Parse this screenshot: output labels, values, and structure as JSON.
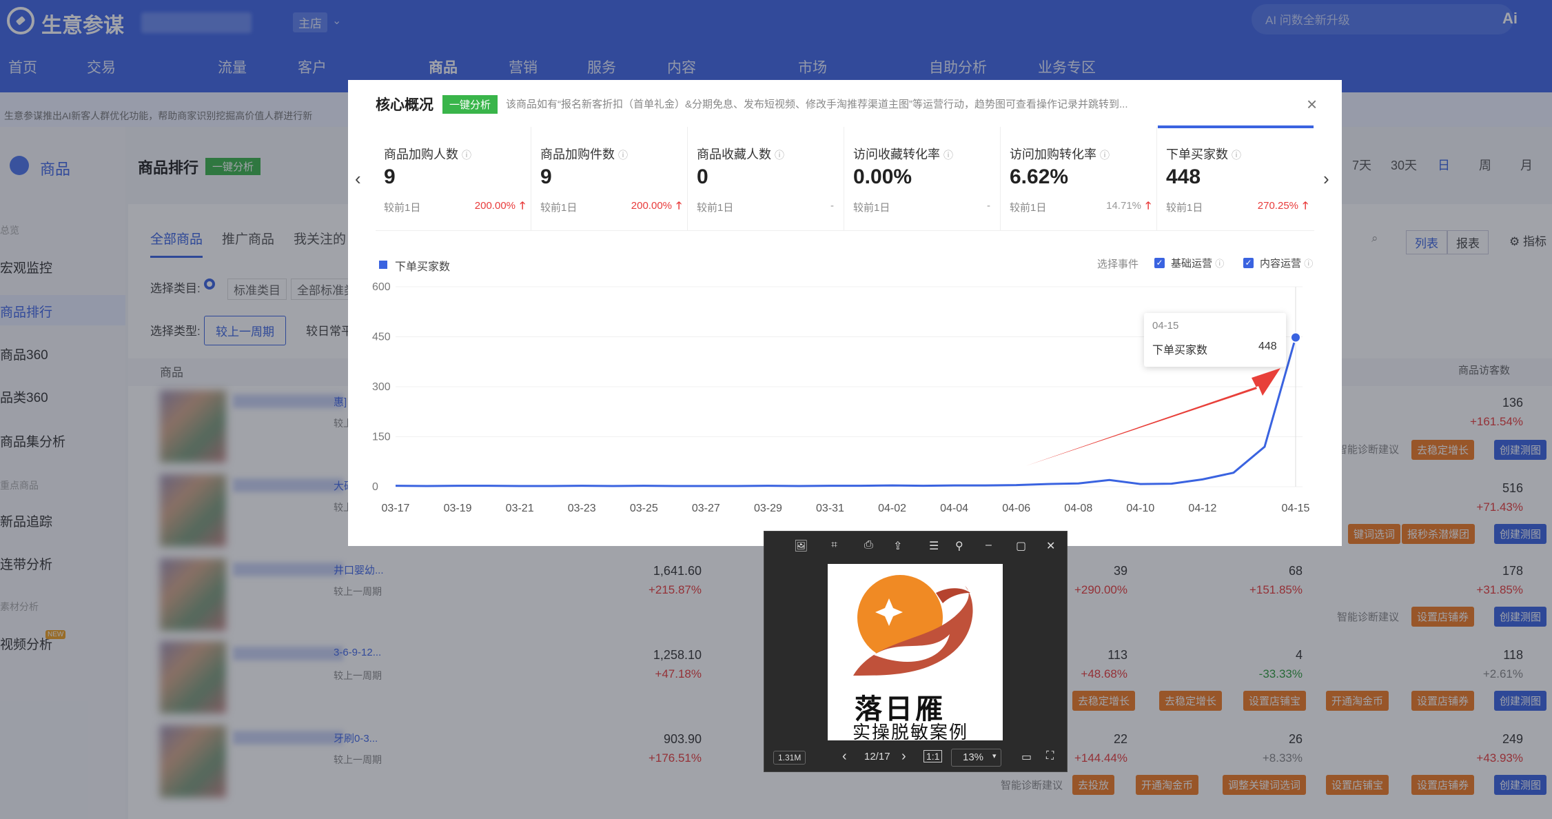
{
  "app": {
    "brand": "生意参谋",
    "shop_badge": "主店",
    "ai_search_placeholder": "AI 问数全新升级"
  },
  "nav": [
    "首页",
    "交易",
    "流量",
    "客户",
    "商品",
    "营销",
    "服务",
    "内容",
    "市场",
    "自助分析",
    "业务专区"
  ],
  "announcement": "生意参谋推出AI新客人群优化功能，帮助商家识别挖掘高价值人群进行新",
  "sidebar": {
    "title": "商品",
    "groups": [
      {
        "label": "总览",
        "items": [
          "宏观监控",
          "商品排行",
          "商品360",
          "品类360",
          "商品集分析"
        ]
      },
      {
        "label": "重点商品",
        "items": [
          "新品追踪",
          "连带分析"
        ]
      },
      {
        "label": "素材分析",
        "items": [
          "视频分析"
        ]
      }
    ],
    "new_badge": "NEW"
  },
  "main": {
    "title": "商品排行",
    "ai_button": "一键分析",
    "periods": [
      "7天",
      "30天",
      "日",
      "周",
      "月"
    ],
    "tabs": [
      "全部商品",
      "推广商品",
      "我关注的"
    ],
    "filter_category_label": "选择类目:",
    "filter_category_values": [
      "标准类目",
      "全部标准类"
    ],
    "filter_type_label": "选择类型:",
    "filter_type_values": [
      "较上一周期",
      "较日常平"
    ],
    "view_buttons": [
      "列表",
      "报表"
    ],
    "indicator_button": "指标",
    "col_product": "商品",
    "col_visitors": "商品访客数",
    "rows": [
      {
        "suffix": "惠]",
        "cmp": "较上",
        "visitors": "136",
        "visitors_pct": "+161.54%",
        "tags": [
          "去稳定增长"
        ]
      },
      {
        "suffix": "大码",
        "cmp": "较上",
        "visitors": "516",
        "visitors_pct": "+71.43%",
        "tags": [
          "键词选词",
          "报秒杀潜爆团"
        ]
      },
      {
        "suffix": "井口婴幼...",
        "cmp": "较上一周期",
        "amount": "1,641.60",
        "amount_pct": "+215.87%",
        "c1": "39",
        "c1_pct": "+290.00%",
        "c2": "68",
        "c2_pct": "+151.85%",
        "visitors": "178",
        "visitors_pct": "+31.85%",
        "tags": [
          "设置店铺券"
        ]
      },
      {
        "suffix": "3-6-9-12...",
        "cmp": "较上一周期",
        "amount": "1,258.10",
        "amount_pct": "+47.18%",
        "c1": "113",
        "c1_pct": "+48.68%",
        "c2": "4",
        "c2_pct": "-33.33%",
        "visitors": "118",
        "visitors_pct": "+2.61%",
        "tags": [
          "去稳定增长",
          "去稳定增长",
          "设置店铺宝",
          "开通淘金币",
          "设置店铺券"
        ]
      },
      {
        "suffix": "牙刷0-3...",
        "cmp": "较上一周期",
        "amount": "903.90",
        "amount_pct": "+176.51%",
        "c1": "22",
        "c1_pct": "+144.44%",
        "c2": "26",
        "c2_pct": "+8.33%",
        "visitors": "249",
        "visitors_pct": "+43.93%",
        "tags": [
          "去投放",
          "开通淘金币",
          "调整关键词选词",
          "设置店铺宝",
          "设置店铺券"
        ]
      }
    ],
    "diag_label": "智能诊断建议",
    "create_label": "创建测图"
  },
  "modal": {
    "title": "核心概况",
    "ai_button": "一键分析",
    "description": "该商品如有“报名新客折扣（首单礼金）&分期免息、发布短视频、修改手淘推荐渠道主图”等运营行动，趋势图可查看操作记录并跳转到...",
    "close": "×",
    "metrics": [
      {
        "label": "商品加购人数",
        "value": "9",
        "compare_label": "较前1日",
        "change": "200.00%",
        "trend": "up"
      },
      {
        "label": "商品加购件数",
        "value": "9",
        "compare_label": "较前1日",
        "change": "200.00%",
        "trend": "up"
      },
      {
        "label": "商品收藏人数",
        "value": "0",
        "compare_label": "较前1日",
        "change": "-",
        "trend": "none"
      },
      {
        "label": "访问收藏转化率",
        "value": "0.00%",
        "compare_label": "较前1日",
        "change": "-",
        "trend": "none"
      },
      {
        "label": "访问加购转化率",
        "value": "6.62%",
        "compare_label": "较前1日",
        "change": "14.71%",
        "trend": "up-gray"
      },
      {
        "label": "下单买家数",
        "value": "448",
        "compare_label": "较前1日",
        "change": "270.25%",
        "trend": "up",
        "selected": true
      }
    ],
    "legend": "下单买家数",
    "event_label": "选择事件",
    "events": [
      {
        "label": "基础运营",
        "checked": true
      },
      {
        "label": "内容运营",
        "checked": true
      }
    ],
    "tooltip": {
      "date": "04-15",
      "label": "下单买家数",
      "value": "448"
    }
  },
  "chart_data": {
    "type": "line",
    "title": "",
    "xlabel": "",
    "ylabel": "",
    "ylim": [
      0,
      600
    ],
    "yticks": [
      0,
      150,
      300,
      450,
      600
    ],
    "x": [
      "03-17",
      "03-18",
      "03-19",
      "03-20",
      "03-21",
      "03-22",
      "03-23",
      "03-24",
      "03-25",
      "03-26",
      "03-27",
      "03-28",
      "03-29",
      "03-30",
      "03-31",
      "04-01",
      "04-02",
      "04-03",
      "04-04",
      "04-05",
      "04-06",
      "04-07",
      "04-08",
      "04-09",
      "04-10",
      "04-11",
      "04-12",
      "04-13",
      "04-14",
      "04-15"
    ],
    "xtick_labels": [
      "03-17",
      "03-19",
      "03-21",
      "03-23",
      "03-25",
      "03-27",
      "03-29",
      "03-31",
      "04-02",
      "04-04",
      "04-06",
      "04-08",
      "04-10",
      "04-12",
      "04-15"
    ],
    "series": [
      {
        "name": "下单买家数",
        "color": "#3a63e0",
        "values": [
          3,
          2,
          3,
          3,
          2,
          2,
          3,
          2,
          3,
          2,
          2,
          2,
          3,
          2,
          3,
          3,
          4,
          3,
          4,
          4,
          5,
          8,
          10,
          20,
          8,
          9,
          22,
          42,
          120,
          448
        ]
      }
    ],
    "grid": true,
    "highlight_index": 29
  },
  "viewer": {
    "image_title_1": "落日雁",
    "image_title_2": "实操脱敏案例",
    "file_size": "1.31M",
    "page": "12/17",
    "zoom": "13%"
  },
  "colors": {
    "accent": "#3a63e0",
    "topbar": "#4066e6",
    "up": "#e83b3b",
    "down": "#2e9b3c",
    "arrow": "#e8403a"
  }
}
